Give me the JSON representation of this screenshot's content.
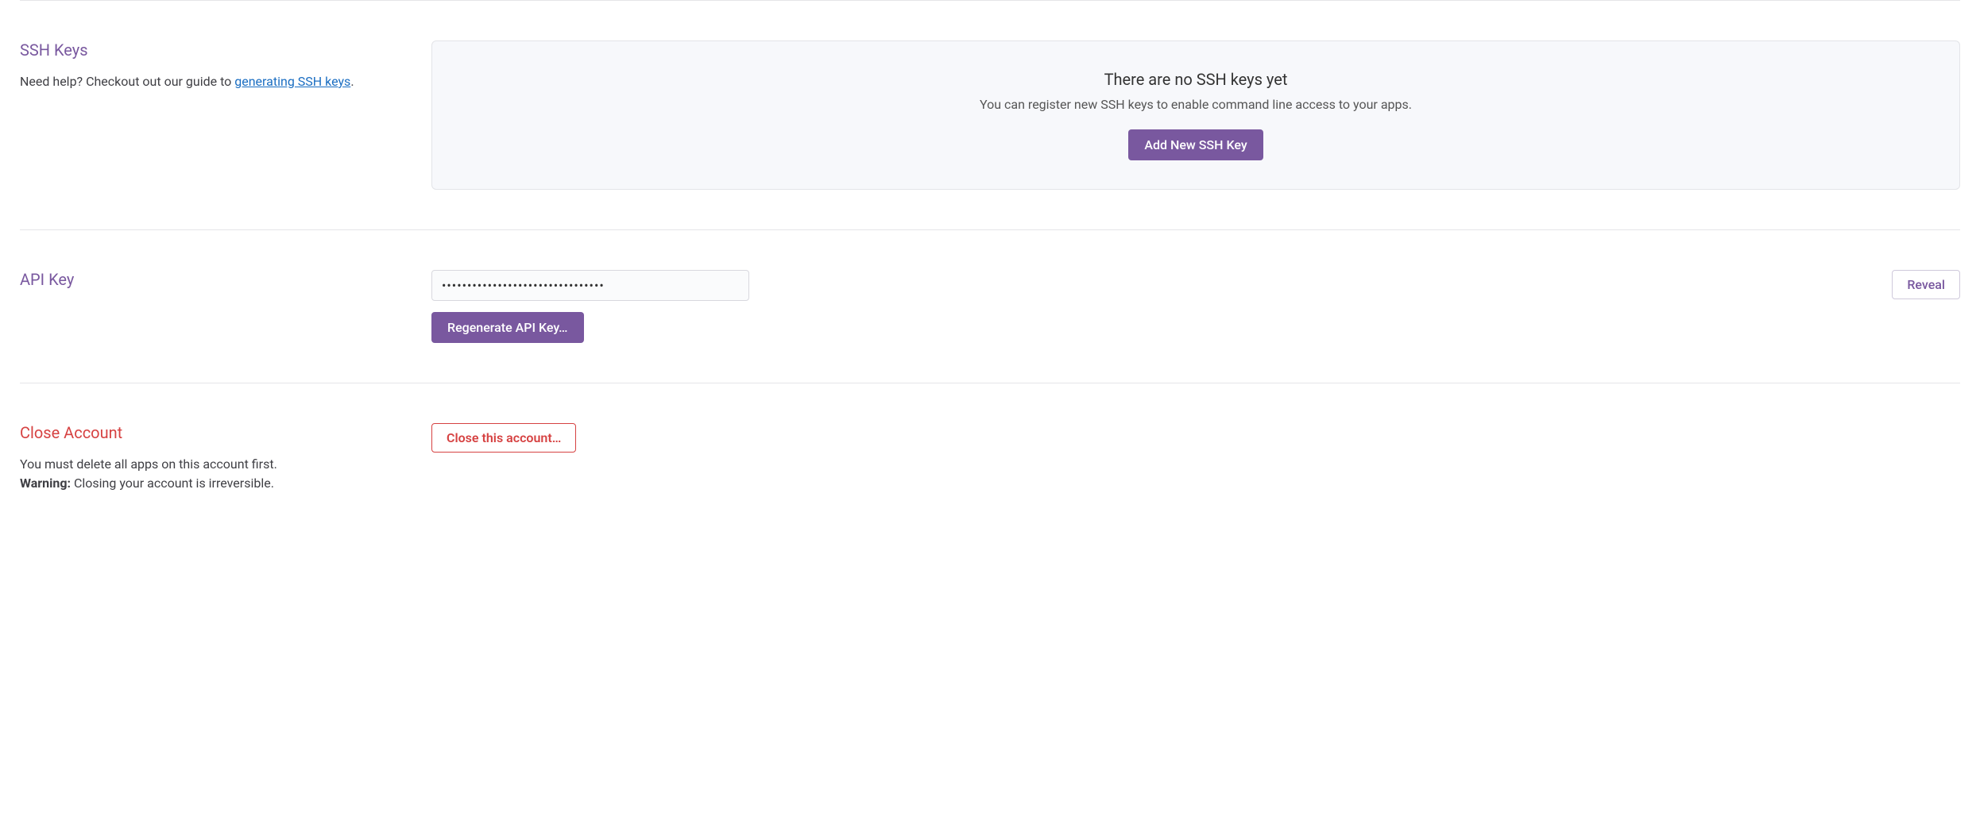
{
  "ssh": {
    "heading": "SSH Keys",
    "help_prefix": "Need help? Checkout out our guide to ",
    "help_link": "generating SSH keys",
    "help_suffix": ".",
    "empty_title": "There are no SSH keys yet",
    "empty_subtitle": "You can register new SSH keys to enable command line access to your apps.",
    "add_button": "Add New SSH Key"
  },
  "api": {
    "heading": "API Key",
    "key_value": "••••••••••••••••••••••••••••••••",
    "reveal_button": "Reveal",
    "regenerate_button": "Regenerate API Key…"
  },
  "close": {
    "heading": "Close Account",
    "instruction": "You must delete all apps on this account first.",
    "warning_label": "Warning:",
    "warning_text": " Closing your account is irreversible.",
    "close_button": "Close this account…"
  }
}
